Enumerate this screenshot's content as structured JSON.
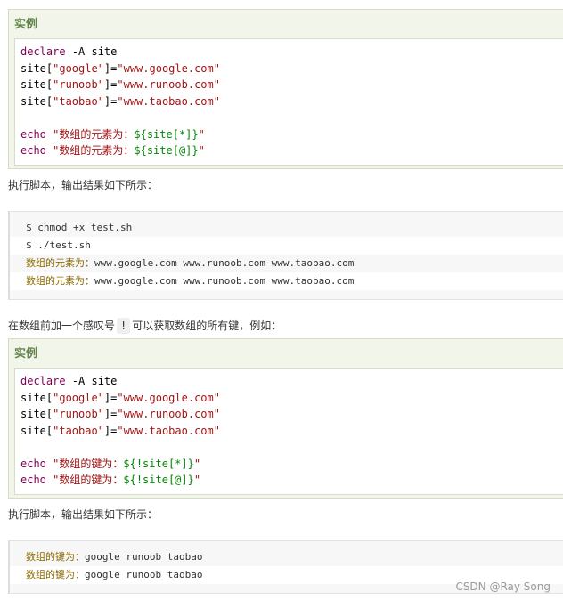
{
  "example1": {
    "title": "实例",
    "lines": [
      [
        {
          "t": "declare",
          "c": "kw"
        },
        {
          "t": " -A site",
          "c": ""
        }
      ],
      [
        {
          "t": "site[",
          "c": ""
        },
        {
          "t": "\"google\"",
          "c": "str"
        },
        {
          "t": "]=",
          "c": ""
        },
        {
          "t": "\"www.google.com\"",
          "c": "str"
        }
      ],
      [
        {
          "t": "site[",
          "c": ""
        },
        {
          "t": "\"runoob\"",
          "c": "str"
        },
        {
          "t": "]=",
          "c": ""
        },
        {
          "t": "\"www.runoob.com\"",
          "c": "str"
        }
      ],
      [
        {
          "t": "site[",
          "c": ""
        },
        {
          "t": "\"taobao\"",
          "c": "str"
        },
        {
          "t": "]=",
          "c": ""
        },
        {
          "t": "\"www.taobao.com\"",
          "c": "str"
        }
      ],
      [],
      [
        {
          "t": "echo",
          "c": "kw"
        },
        {
          "t": " ",
          "c": ""
        },
        {
          "t": "\"数组的元素为：",
          "c": "str"
        },
        {
          "t": "${site[*]}",
          "c": "var"
        },
        {
          "t": "\"",
          "c": "str"
        }
      ],
      [
        {
          "t": "echo",
          "c": "kw"
        },
        {
          "t": " ",
          "c": ""
        },
        {
          "t": "\"数组的元素为：",
          "c": "str"
        },
        {
          "t": "${site[@]}",
          "c": "var"
        },
        {
          "t": "\"",
          "c": "str"
        }
      ]
    ]
  },
  "text1": "执行脚本，输出结果如下所示：",
  "output1": [
    "$ chmod +x test.sh",
    "$ ./test.sh",
    "数组的元素为：www.google.com www.runoob.com www.taobao.com",
    "数组的元素为：www.google.com www.runoob.com www.taobao.com"
  ],
  "text2": {
    "before": "在数组前加一个感叹号",
    "code": "!",
    "after": "可以获取数组的所有键，例如："
  },
  "example2": {
    "title": "实例",
    "lines": [
      [
        {
          "t": "declare",
          "c": "kw"
        },
        {
          "t": " -A site",
          "c": ""
        }
      ],
      [
        {
          "t": "site[",
          "c": ""
        },
        {
          "t": "\"google\"",
          "c": "str"
        },
        {
          "t": "]=",
          "c": ""
        },
        {
          "t": "\"www.google.com\"",
          "c": "str"
        }
      ],
      [
        {
          "t": "site[",
          "c": ""
        },
        {
          "t": "\"runoob\"",
          "c": "str"
        },
        {
          "t": "]=",
          "c": ""
        },
        {
          "t": "\"www.runoob.com\"",
          "c": "str"
        }
      ],
      [
        {
          "t": "site[",
          "c": ""
        },
        {
          "t": "\"taobao\"",
          "c": "str"
        },
        {
          "t": "]=",
          "c": ""
        },
        {
          "t": "\"www.taobao.com\"",
          "c": "str"
        }
      ],
      [],
      [
        {
          "t": "echo",
          "c": "kw"
        },
        {
          "t": " ",
          "c": ""
        },
        {
          "t": "\"数组的键为：",
          "c": "str"
        },
        {
          "t": "${!site[*]}",
          "c": "var"
        },
        {
          "t": "\"",
          "c": "str"
        }
      ],
      [
        {
          "t": "echo",
          "c": "kw"
        },
        {
          "t": " ",
          "c": ""
        },
        {
          "t": "\"数组的键为：",
          "c": "str"
        },
        {
          "t": "${!site[@]}",
          "c": "var"
        },
        {
          "t": "\"",
          "c": "str"
        }
      ]
    ]
  },
  "text3": "执行脚本，输出结果如下所示：",
  "output2": [
    "数组的键为：google runoob taobao",
    "数组的键为：google runoob taobao"
  ],
  "watermark": "CSDN @Ray Song"
}
